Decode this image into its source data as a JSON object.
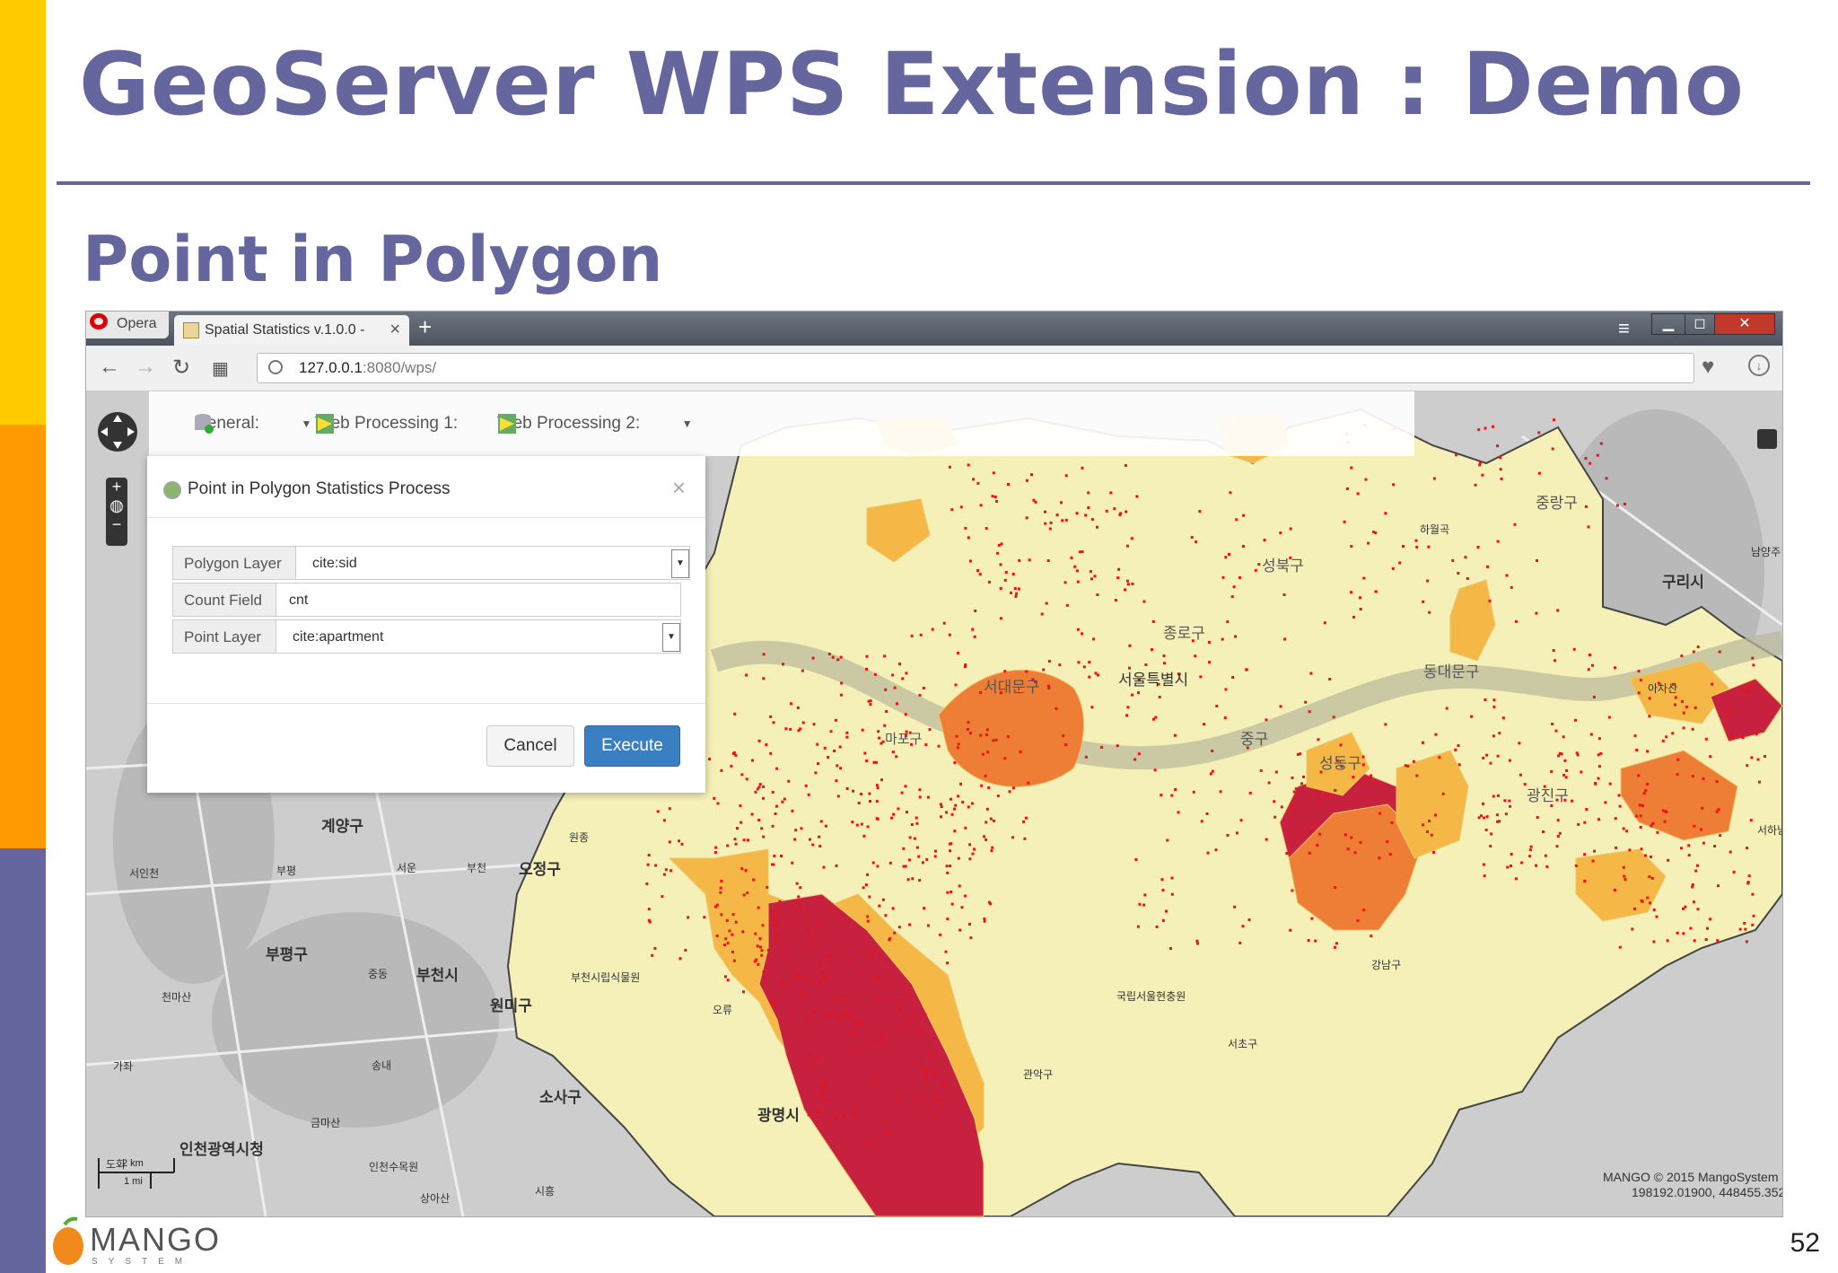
{
  "slide": {
    "title": "GeoServer WPS Extension : Demo",
    "subtitle": "Point in Polygon",
    "page_number": "52",
    "logo_text": "MANGO",
    "logo_sub": "SYSTEM"
  },
  "browser": {
    "opera_label": "Opera",
    "tab_title": "Spatial Statistics v.1.0.0 -",
    "url_host": "127.0.0.1",
    "url_rest": ":8080/wps/"
  },
  "toolbar": {
    "general_label": "General:",
    "wp1_label": "Web Processing 1:",
    "wp2_label": "Web Processing 2:"
  },
  "dialog": {
    "title": "Point in Polygon Statistics Process",
    "fields": [
      {
        "label": "Polygon Layer",
        "value": "cite:sid"
      },
      {
        "label": "Count Field",
        "value": "cnt"
      },
      {
        "label": "Point Layer",
        "value": "cite:apartment"
      }
    ],
    "cancel_label": "Cancel",
    "execute_label": "Execute"
  },
  "map": {
    "labels": [
      "계양구",
      "오정구",
      "부평구",
      "부천시",
      "원미구",
      "소사구",
      "광명시",
      "인천광역시청",
      "구리시",
      "성북구",
      "종로구",
      "서대문구",
      "마포구",
      "중구",
      "성동구",
      "광진구",
      "동대문구",
      "중랑구",
      "서울특별시"
    ],
    "small_labels": [
      "서인천",
      "부평",
      "서운",
      "부천",
      "원종",
      "송내",
      "중동",
      "천마산",
      "가좌",
      "도화",
      "인천수목원",
      "상아산",
      "금마산",
      "시흥",
      "부천시립식물원",
      "오류",
      "관악구",
      "국립서울현충원",
      "서초구",
      "강남구",
      "하월곡",
      "아차산",
      "남양주",
      "서하남"
    ],
    "scale_km": "2 km",
    "scale_mi": "1 mi",
    "copyright": "MANGO   © 2015 MangoSystem",
    "coords": "198192.01900, 448455.35200"
  },
  "colors": {
    "accent": "#66669e",
    "sidebar_yellow": "#ffcc00",
    "sidebar_orange": "#ff9900",
    "execute_blue": "#3a7fc1",
    "point_red": "#ee1111",
    "poly_dark": "#c8213f",
    "poly_mid": "#ee7d36",
    "poly_light": "#f5b746",
    "poly_pale": "#f5f0b8"
  },
  "icons": [
    "back-arrow-icon",
    "forward-arrow-icon",
    "reload-icon",
    "speed-dial-icon",
    "globe-icon",
    "heart-icon",
    "download-icon",
    "pan-icon",
    "zoom-in-icon",
    "zoom-out-icon",
    "database-add-icon",
    "process-icon",
    "layers-icon",
    "close-icon"
  ]
}
